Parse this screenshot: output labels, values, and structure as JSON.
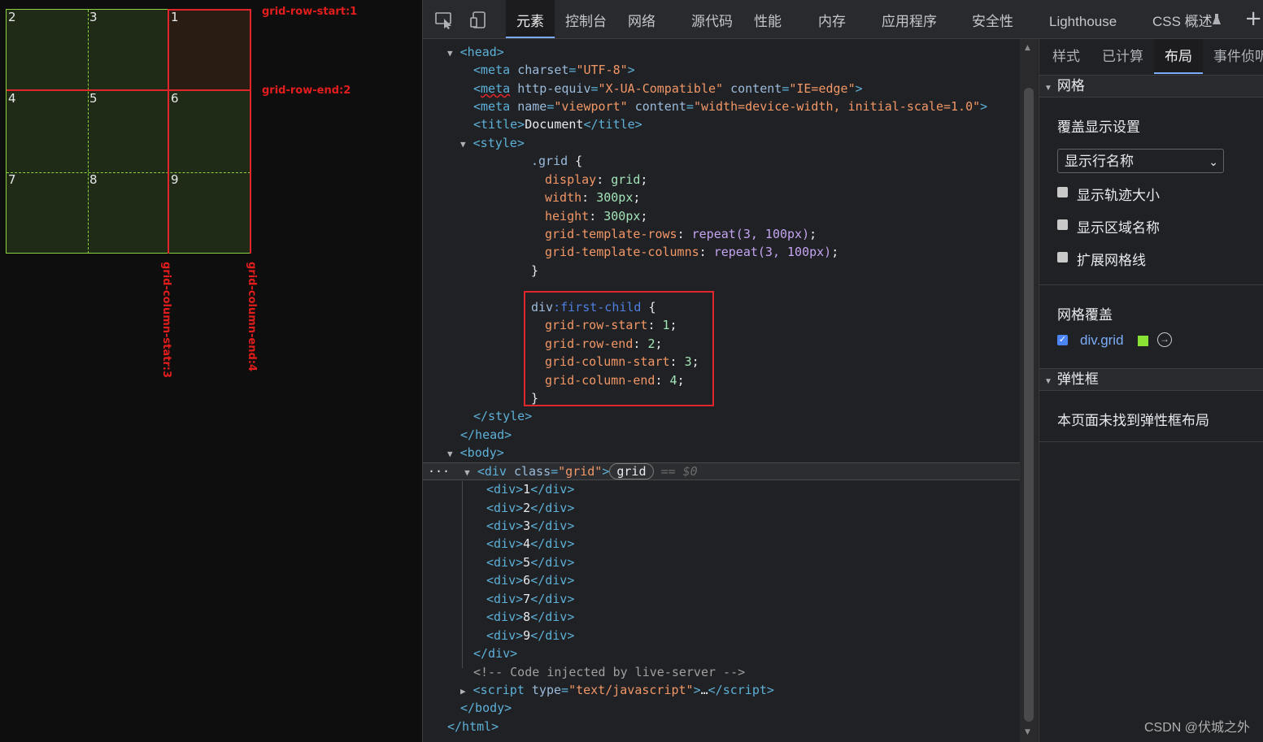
{
  "preview": {
    "cells": [
      "2",
      "3",
      "1",
      "4",
      "5",
      "6",
      "7",
      "8",
      "9"
    ],
    "annotations": {
      "row_start": "grid-row-start:1",
      "row_end": "grid-row-end:2",
      "col_start": "grid-column-statr:3",
      "col_end": "grid-column-end:4"
    }
  },
  "toolbar": {
    "tabs": [
      "元素",
      "控制台",
      "网络",
      "源代码",
      "性能",
      "内存",
      "应用程序",
      "安全性",
      "Lighthouse",
      "CSS 概述"
    ],
    "active_tab": "元素",
    "plus": "+"
  },
  "code": {
    "head_open": "<head>",
    "meta1": "<meta charset=\"UTF-8\">",
    "meta2_tag": "meta",
    "meta2_a1": "http-equiv",
    "meta2_v1": "\"X-UA-Compatible\"",
    "meta2_a2": "content",
    "meta2_v2": "\"IE=edge\"",
    "meta3_a1": "name",
    "meta3_v1": "\"viewport\"",
    "meta3_a2": "content",
    "meta3_v2": "\"width=device-width, initial-scale=1.0\"",
    "title_text": "Document",
    "style_open": "<style>",
    "grid_sel": ".grid",
    "grid_props": [
      {
        "p": "display",
        "v": "grid"
      },
      {
        "p": "width",
        "v": "300px"
      },
      {
        "p": "height",
        "v": "300px"
      },
      {
        "p": "grid-template-rows",
        "v": "repeat(3, 100px)"
      },
      {
        "p": "grid-template-columns",
        "v": "repeat(3, 100px)"
      }
    ],
    "fc_sel": "div",
    "fc_pseudo": ":first-child",
    "fc_props": [
      {
        "p": "grid-row-start",
        "v": "1"
      },
      {
        "p": "grid-row-end",
        "v": "2"
      },
      {
        "p": "grid-column-start",
        "v": "3"
      },
      {
        "p": "grid-column-end",
        "v": "4"
      }
    ],
    "style_close": "</style>",
    "head_close": "</head>",
    "body_open": "<body>",
    "div_class": "\"grid\"",
    "grid_pill": "grid",
    "dollar": "== $0",
    "children": [
      "1",
      "2",
      "3",
      "4",
      "5",
      "6",
      "7",
      "8",
      "9"
    ],
    "div_close": "</div>",
    "comment": "<!-- Code injected by live-server -->",
    "script_type": "\"text/javascript\"",
    "body_close": "</body>",
    "html_close": "</html>"
  },
  "side": {
    "tabs": [
      "样式",
      "已计算",
      "布局",
      "事件侦听"
    ],
    "active_tab": "布局",
    "grid_section": "网格",
    "overlay_settings": "覆盖显示设置",
    "select_value": "显示行名称",
    "checkboxes": [
      "显示轨迹大小",
      "显示区域名称",
      "扩展网格线"
    ],
    "grid_overlay": "网格覆盖",
    "grid_item": "div.grid",
    "flex_section": "弹性框",
    "flex_empty": "本页面未找到弹性框布局",
    "swatch_color": "#8ae234"
  },
  "watermark": "CSDN @伏城之外"
}
